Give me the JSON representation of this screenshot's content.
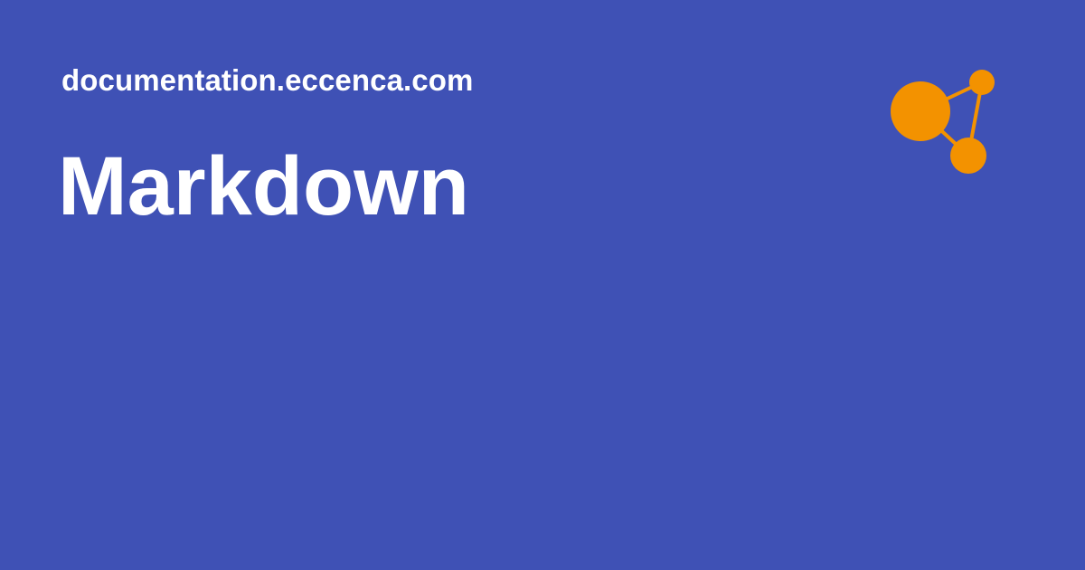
{
  "site": {
    "domain": "documentation.eccenca.com"
  },
  "page": {
    "title": "Markdown"
  },
  "logo": {
    "icon": "eccenca-graph-logo-icon",
    "color": "#f39200"
  },
  "colors": {
    "background": "#3f51b5",
    "text": "#ffffff",
    "accent": "#f39200"
  }
}
